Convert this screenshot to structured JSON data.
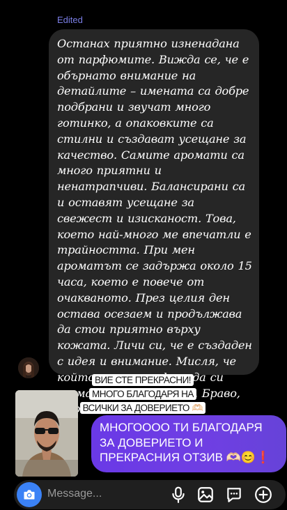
{
  "header": {
    "edited_label": "Edited"
  },
  "incoming_message": {
    "text": "Останах приятно изненадана от парфюмите. Вижда се, че е обърнато внимание на детайлите – имената са добре подбрани и звучат много готинко, а опаковките са стилни и създават усещане за качество. Самите аромати са много приятни и ненатрапчиви. Балансирани са и оставят усещане за свежест и изисканост. Това, което най-много ме впечатли е трайността. При мен ароматът се задържа около 15 часа, което е повече от очакваното. През целия ден остава осезаем и продължава да стои приятно върху кожата. Личи си, че е създаден с идея и внимание. Мисля, че който номер  парфюм да си взема, няма да сгреша. Браво, моряче!"
  },
  "story_reply": {
    "caption": "ВИЕ СТЕ ПРЕКРАСНИ! МНОГО БЛАГОДАРЯ НА ВСИЧКИ ЗА ДОВЕРИЕТО 🫶🏻"
  },
  "outgoing_message": {
    "text": "МНОГОООО ТИ БЛАГОДАРЯ ЗА ДОВЕРИЕТО И ПРЕКРАСНИЯ ОТЗИВ 🫶🏻😊❗️"
  },
  "composer": {
    "placeholder": "Message...",
    "icons": [
      "camera-icon",
      "microphone-icon",
      "gallery-icon",
      "sticker-icon",
      "plus-icon"
    ],
    "accent": "#3b82f6"
  },
  "colors": {
    "incoming_bubble": "#262626",
    "outgoing_bubble": "#6a39e6",
    "edited_label": "#7b7fe6"
  }
}
